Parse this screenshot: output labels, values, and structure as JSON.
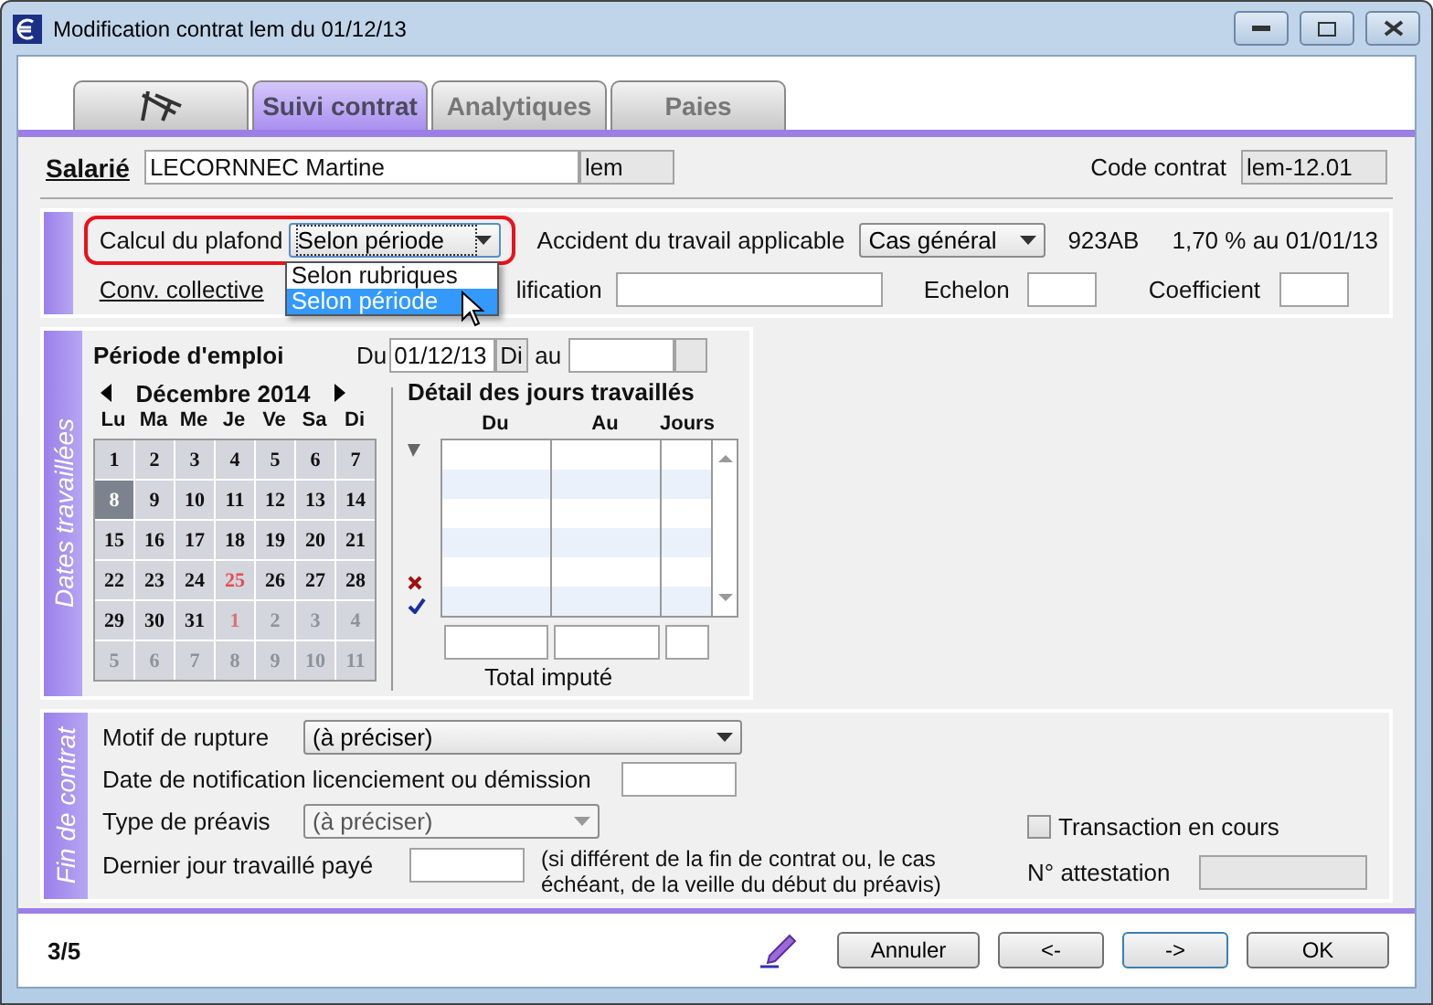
{
  "window": {
    "title": "Modification contrat lem du 01/12/13"
  },
  "tabs": [
    {
      "kind": "icon",
      "selected": false
    },
    {
      "kind": "text",
      "label": "Suivi contrat",
      "selected": true
    },
    {
      "kind": "text",
      "label": "Analytiques",
      "selected": false
    },
    {
      "kind": "text",
      "label": "Paies",
      "selected": false
    }
  ],
  "employee": {
    "label": "Salarié",
    "name": "LECORNNEC Martine",
    "code": "lem"
  },
  "contract_code": {
    "label": "Code contrat",
    "value": "lem-12.01"
  },
  "contract": {
    "ceiling": {
      "label": "Calcul du plafond",
      "value": "Selon période",
      "highlighted": true,
      "expanded": true,
      "options": [
        {
          "label": "Selon rubriques",
          "selected": false
        },
        {
          "label": "Selon période",
          "selected": true
        }
      ]
    },
    "accident": {
      "label": "Accident du travail applicable",
      "value": "Cas général"
    },
    "code": "923AB",
    "rate": "1,70 % au 01/01/13",
    "agreement_link": "Conv. collective",
    "qualification_label": "lification",
    "echelon_label": "Echelon",
    "coefficient_label": "Coefficient"
  },
  "dates_section": {
    "title": "Dates travaillées",
    "period_label": "Période d'emploi",
    "from_label": "Du",
    "from_value": "01/12/13",
    "from_day": "Di",
    "to_label": "au",
    "calendar": {
      "month": "Décembre 2014",
      "weekdays": [
        "Lu",
        "Ma",
        "Me",
        "Je",
        "Ve",
        "Sa",
        "Di"
      ],
      "weeks": [
        [
          {
            "day": "1",
            "muted": false,
            "holiday": false,
            "selected": false
          },
          {
            "day": "2",
            "muted": false,
            "holiday": false,
            "selected": false
          },
          {
            "day": "3",
            "muted": false,
            "holiday": false,
            "selected": false
          },
          {
            "day": "4",
            "muted": false,
            "holiday": false,
            "selected": false
          },
          {
            "day": "5",
            "muted": false,
            "holiday": false,
            "selected": false
          },
          {
            "day": "6",
            "muted": false,
            "holiday": false,
            "selected": false
          },
          {
            "day": "7",
            "muted": false,
            "holiday": false,
            "selected": false
          }
        ],
        [
          {
            "day": "8",
            "muted": false,
            "holiday": false,
            "selected": true
          },
          {
            "day": "9",
            "muted": false,
            "holiday": false,
            "selected": false
          },
          {
            "day": "10",
            "muted": false,
            "holiday": false,
            "selected": false
          },
          {
            "day": "11",
            "muted": false,
            "holiday": false,
            "selected": false
          },
          {
            "day": "12",
            "muted": false,
            "holiday": false,
            "selected": false
          },
          {
            "day": "13",
            "muted": false,
            "holiday": false,
            "selected": false
          },
          {
            "day": "14",
            "muted": false,
            "holiday": false,
            "selected": false
          }
        ],
        [
          {
            "day": "15",
            "muted": false,
            "holiday": false,
            "selected": false
          },
          {
            "day": "16",
            "muted": false,
            "holiday": false,
            "selected": false
          },
          {
            "day": "17",
            "muted": false,
            "holiday": false,
            "selected": false
          },
          {
            "day": "18",
            "muted": false,
            "holiday": false,
            "selected": false
          },
          {
            "day": "19",
            "muted": false,
            "holiday": false,
            "selected": false
          },
          {
            "day": "20",
            "muted": false,
            "holiday": false,
            "selected": false
          },
          {
            "day": "21",
            "muted": false,
            "holiday": false,
            "selected": false
          }
        ],
        [
          {
            "day": "22",
            "muted": false,
            "holiday": false,
            "selected": false
          },
          {
            "day": "23",
            "muted": false,
            "holiday": false,
            "selected": false
          },
          {
            "day": "24",
            "muted": false,
            "holiday": false,
            "selected": false
          },
          {
            "day": "25",
            "muted": false,
            "holiday": true,
            "selected": false
          },
          {
            "day": "26",
            "muted": false,
            "holiday": false,
            "selected": false
          },
          {
            "day": "27",
            "muted": false,
            "holiday": false,
            "selected": false
          },
          {
            "day": "28",
            "muted": false,
            "holiday": false,
            "selected": false
          }
        ],
        [
          {
            "day": "29",
            "muted": false,
            "holiday": false,
            "selected": false
          },
          {
            "day": "30",
            "muted": false,
            "holiday": false,
            "selected": false
          },
          {
            "day": "31",
            "muted": false,
            "holiday": false,
            "selected": false
          },
          {
            "day": "1",
            "muted": true,
            "holiday": true,
            "selected": false
          },
          {
            "day": "2",
            "muted": true,
            "holiday": false,
            "selected": false
          },
          {
            "day": "3",
            "muted": true,
            "holiday": false,
            "selected": false
          },
          {
            "day": "4",
            "muted": true,
            "holiday": false,
            "selected": false
          }
        ],
        [
          {
            "day": "5",
            "muted": true,
            "holiday": false,
            "selected": false
          },
          {
            "day": "6",
            "muted": true,
            "holiday": false,
            "selected": false
          },
          {
            "day": "7",
            "muted": true,
            "holiday": false,
            "selected": false
          },
          {
            "day": "8",
            "muted": true,
            "holiday": false,
            "selected": false
          },
          {
            "day": "9",
            "muted": true,
            "holiday": false,
            "selected": false
          },
          {
            "day": "10",
            "muted": true,
            "holiday": false,
            "selected": false
          },
          {
            "day": "11",
            "muted": true,
            "holiday": false,
            "selected": false
          }
        ]
      ]
    },
    "detail": {
      "title": "Détail des jours travaillés",
      "columns": [
        "Du",
        "Au",
        "Jours"
      ],
      "total_label": "Total imputé"
    }
  },
  "end_section": {
    "title": "Fin de contrat",
    "reason": {
      "label": "Motif de rupture",
      "value": "(à préciser)",
      "disabled": false
    },
    "notice_date_label": "Date de notification licenciement ou démission",
    "notice_type": {
      "label": "Type de préavis",
      "value": "(à préciser)",
      "disabled": true
    },
    "last_day_label": "Dernier jour travaillé payé",
    "last_day_note": "(si différent de la fin de contrat ou, le cas échéant, de la veille du début du préavis)",
    "transaction": {
      "label": "Transaction en cours",
      "checked": false
    },
    "attestation_label": "N° attestation"
  },
  "footer": {
    "page": "3/5",
    "buttons": [
      "Annuler",
      "<-",
      "->",
      "OK"
    ]
  }
}
